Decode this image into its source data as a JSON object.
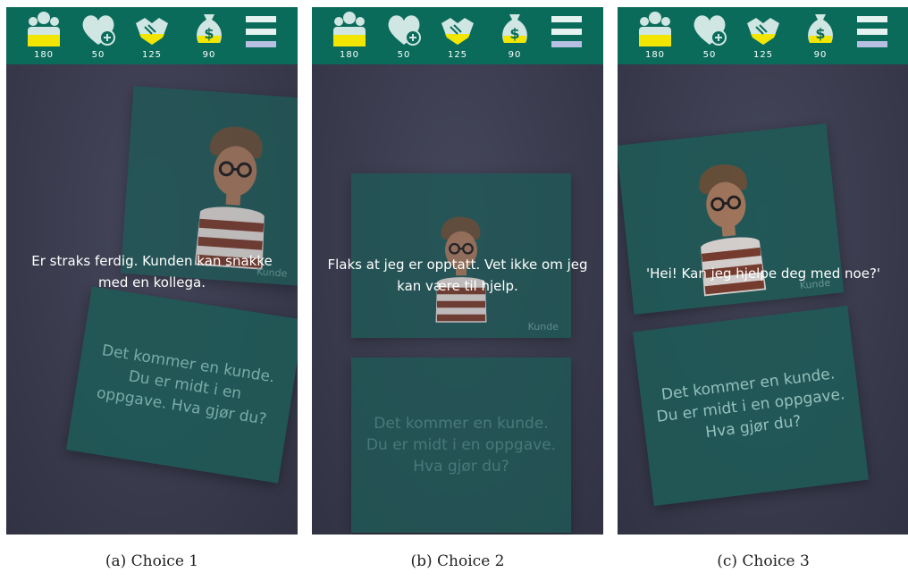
{
  "stats": {
    "people": "180",
    "health": "50",
    "trust": "125",
    "money": "90"
  },
  "icons": {
    "people": "people-group-icon",
    "health": "heart-plus-icon",
    "trust": "handshake-icon",
    "money": "money-bag-icon",
    "menu": "hamburger-menu-icon"
  },
  "colors": {
    "topbar": "#0b6b5a",
    "background": "#3b3c4e",
    "card": "#1f5a57",
    "gauge_fill": "#f2e600"
  },
  "card_prompt": "Det kommer en kunde. Du er midt i en oppgave. Hva gjør du?",
  "character_label": "Kunde",
  "panels": [
    {
      "overlay_text": "Er straks ferdig. Kunden kan snakke med en kollega.",
      "caption": "(a) Choice 1"
    },
    {
      "overlay_text": "Flaks at jeg er opptatt. Vet ikke om jeg kan være til hjelp.",
      "caption": "(b) Choice 2"
    },
    {
      "overlay_text": "'Hei! Kan jeg hjelpe deg med noe?'",
      "caption": "(c) Choice 3"
    }
  ]
}
